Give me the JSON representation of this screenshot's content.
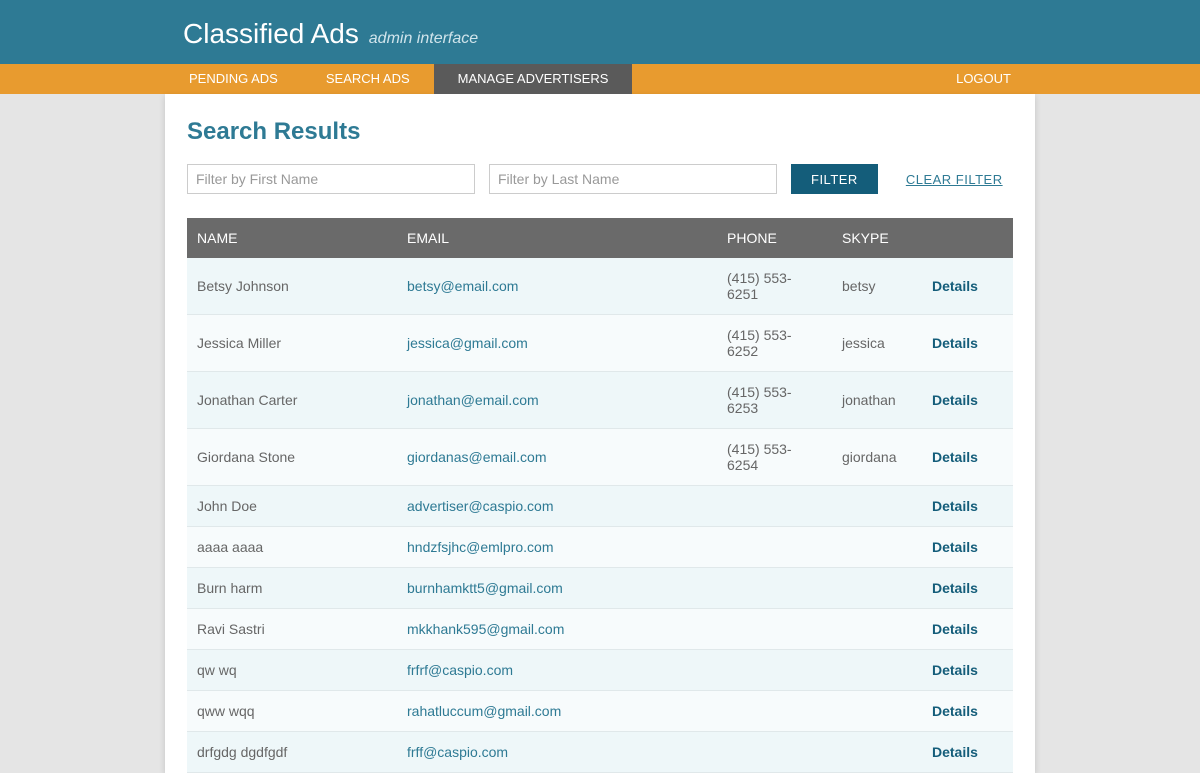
{
  "header": {
    "title": "Classified Ads",
    "subtitle": "admin interface"
  },
  "nav": {
    "items": [
      {
        "label": "PENDING ADS",
        "active": false
      },
      {
        "label": "SEARCH ADS",
        "active": false
      },
      {
        "label": "MANAGE ADVERTISERS",
        "active": true
      }
    ],
    "logout": "LOGOUT"
  },
  "page": {
    "title": "Search Results"
  },
  "filters": {
    "first_name_placeholder": "Filter by First Name",
    "last_name_placeholder": "Filter by Last Name",
    "filter_button": "FILTER",
    "clear_filter": "CLEAR FILTER"
  },
  "table": {
    "headers": {
      "name": "NAME",
      "email": "EMAIL",
      "phone": "PHONE",
      "skype": "SKYPE"
    },
    "details_label": "Details",
    "rows": [
      {
        "name": "Betsy Johnson",
        "email": "betsy@email.com",
        "phone": "(415) 553-6251",
        "skype": "betsy"
      },
      {
        "name": "Jessica Miller",
        "email": "jessica@gmail.com",
        "phone": "(415) 553-6252",
        "skype": "jessica"
      },
      {
        "name": "Jonathan Carter",
        "email": "jonathan@email.com",
        "phone": "(415) 553-6253",
        "skype": "jonathan"
      },
      {
        "name": "Giordana Stone",
        "email": "giordanas@email.com",
        "phone": "(415) 553-6254",
        "skype": "giordana"
      },
      {
        "name": "John Doe",
        "email": "advertiser@caspio.com",
        "phone": "",
        "skype": ""
      },
      {
        "name": "aaaa aaaa",
        "email": "hndzfsjhc@emlpro.com",
        "phone": "",
        "skype": ""
      },
      {
        "name": "Burn harm",
        "email": "burnhamktt5@gmail.com",
        "phone": "",
        "skype": ""
      },
      {
        "name": "Ravi Sastri",
        "email": "mkkhank595@gmail.com",
        "phone": "",
        "skype": ""
      },
      {
        "name": "qw wq",
        "email": "frfrf@caspio.com",
        "phone": "",
        "skype": ""
      },
      {
        "name": "qww wqq",
        "email": "rahatluccum@gmail.com",
        "phone": "",
        "skype": ""
      },
      {
        "name": "drfgdg dgdfgdf",
        "email": "frff@caspio.com",
        "phone": "",
        "skype": ""
      }
    ]
  }
}
